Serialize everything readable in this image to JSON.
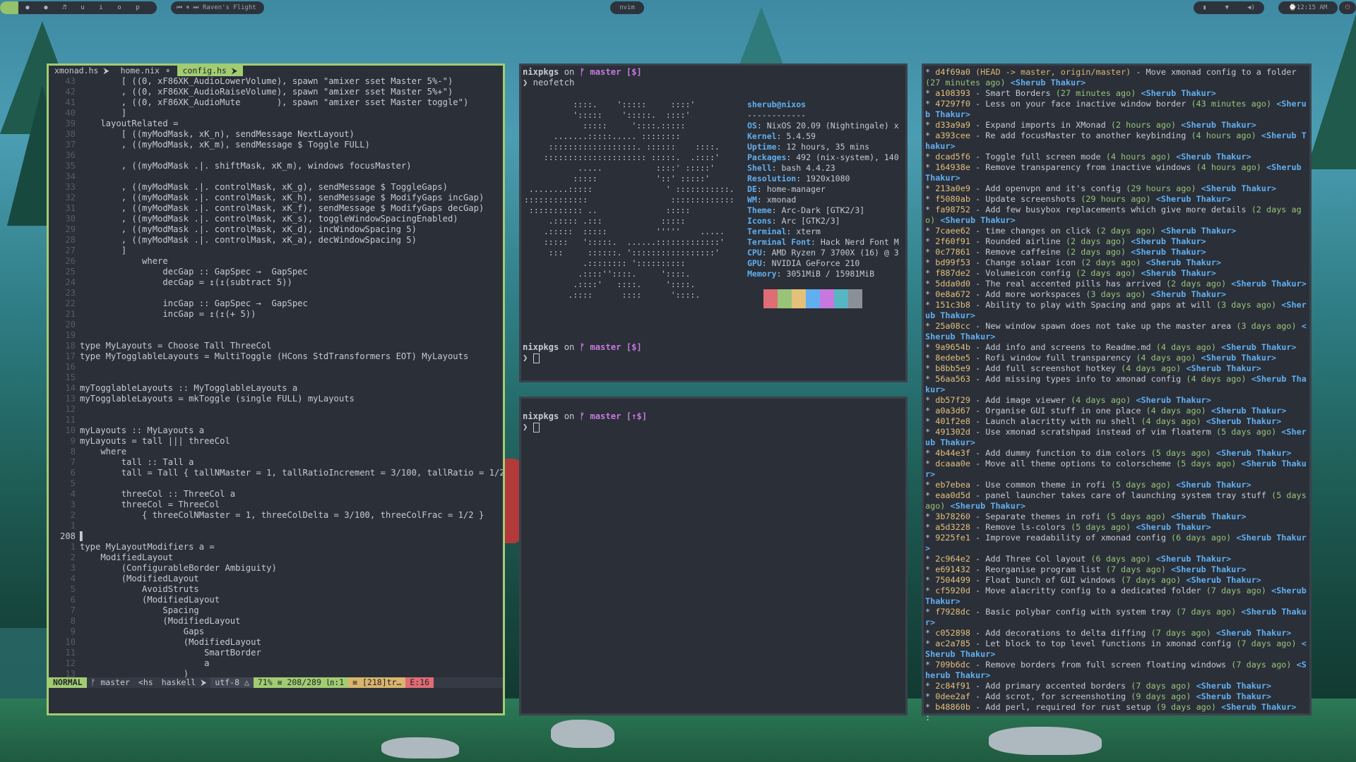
{
  "topbar": {
    "workspaces": [
      "",
      "●",
      "●",
      "♬",
      "u",
      "i",
      "o",
      "p"
    ],
    "music": "⏮ ⏸ ⏭ Raven's Flight",
    "center_title": "nvim",
    "clock": "⌚12:15 AM"
  },
  "nvim": {
    "tabs": [
      "xmonad.hs ⮞",
      "home.nix ⚬",
      "config.hs ⮞"
    ],
    "lines": [
      {
        "n": "43",
        "t": "        [ ((0, xF86XK_AudioLowerVolume), spawn \"amixer sset Master 5%-\")"
      },
      {
        "n": "42",
        "t": "        , ((0, xF86XK_AudioRaiseVolume), spawn \"amixer sset Master 5%+\")"
      },
      {
        "n": "41",
        "t": "        , ((0, xF86XK_AudioMute       ), spawn \"amixer sset Master toggle\")"
      },
      {
        "n": "40",
        "t": "        ]"
      },
      {
        "n": "39",
        "t": "    layoutRelated ="
      },
      {
        "n": "38",
        "t": "        [ ((myModMask, xK_n), sendMessage NextLayout)"
      },
      {
        "n": "37",
        "t": "        , ((myModMask, xK_m), sendMessage $ Toggle FULL)"
      },
      {
        "n": "36",
        "t": ""
      },
      {
        "n": "35",
        "t": "        , ((myModMask .|. shiftMask, xK_m), windows focusMaster)"
      },
      {
        "n": "34",
        "t": ""
      },
      {
        "n": "33",
        "t": "        , ((myModMask .|. controlMask, xK_g), sendMessage $ ToggleGaps)"
      },
      {
        "n": "32",
        "t": "        , ((myModMask .|. controlMask, xK_h), sendMessage $ ModifyGaps incGap)"
      },
      {
        "n": "31",
        "t": "        , ((myModMask .|. controlMask, xK_f), sendMessage $ ModifyGaps decGap)"
      },
      {
        "n": "30",
        "t": "        , ((myModMask .|. controlMask, xK_s), toggleWindowSpacingEnabled)"
      },
      {
        "n": "29",
        "t": "        , ((myModMask .|. controlMask, xK_d), incWindowSpacing 5)"
      },
      {
        "n": "28",
        "t": "        , ((myModMask .|. controlMask, xK_a), decWindowSpacing 5)"
      },
      {
        "n": "27",
        "t": "        ]"
      },
      {
        "n": "26",
        "t": "            where"
      },
      {
        "n": "25",
        "t": "                decGap :: GapSpec →  GapSpec"
      },
      {
        "n": "24",
        "t": "                decGap = ↥(↥(subtract 5))"
      },
      {
        "n": "23",
        "t": ""
      },
      {
        "n": "22",
        "t": "                incGap :: GapSpec →  GapSpec"
      },
      {
        "n": "21",
        "t": "                incGap = ↥(↥(+ 5))"
      },
      {
        "n": "20",
        "t": ""
      },
      {
        "n": "19",
        "t": ""
      },
      {
        "n": "18",
        "t": "type MyLayouts = Choose Tall ThreeCol"
      },
      {
        "n": "17",
        "t": "type MyTogglableLayouts = MultiToggle (HCons StdTransformers EOT) MyLayouts"
      },
      {
        "n": "16",
        "t": ""
      },
      {
        "n": "15",
        "t": ""
      },
      {
        "n": "14",
        "t": "myTogglableLayouts :: MyTogglableLayouts a"
      },
      {
        "n": "13",
        "t": "myTogglableLayouts = mkToggle (single FULL) myLayouts"
      },
      {
        "n": "12",
        "t": ""
      },
      {
        "n": "11",
        "t": ""
      },
      {
        "n": "10",
        "t": "myLayouts :: MyLayouts a"
      },
      {
        "n": "9",
        "t": "myLayouts = tall ||| threeCol"
      },
      {
        "n": "8",
        "t": "    where"
      },
      {
        "n": "7",
        "t": "        tall :: Tall a"
      },
      {
        "n": "6",
        "t": "        tall = Tall { tallNMaster = 1, tallRatioIncrement = 3/100, tallRatio = 1/2 }"
      },
      {
        "n": "5",
        "t": ""
      },
      {
        "n": "4",
        "t": "        threeCol :: ThreeCol a"
      },
      {
        "n": "3",
        "t": "        threeCol = ThreeCol"
      },
      {
        "n": "2",
        "t": "            { threeColNMaster = 1, threeColDelta = 3/100, threeColFrac = 1/2 }"
      },
      {
        "n": "1",
        "t": ""
      },
      {
        "n": "208",
        "t": "▌",
        "cur": true
      },
      {
        "n": "1",
        "t": "type MyLayoutModifiers a ="
      },
      {
        "n": "2",
        "t": "    ModifiedLayout"
      },
      {
        "n": "3",
        "t": "        (ConfigurableBorder Ambiguity)"
      },
      {
        "n": "4",
        "t": "        (ModifiedLayout"
      },
      {
        "n": "5",
        "t": "            AvoidStruts"
      },
      {
        "n": "6",
        "t": "            (ModifiedLayout"
      },
      {
        "n": "7",
        "t": "                Spacing"
      },
      {
        "n": "8",
        "t": "                (ModifiedLayout"
      },
      {
        "n": "9",
        "t": "                    Gaps"
      },
      {
        "n": "10",
        "t": "                    (ModifiedLayout"
      },
      {
        "n": "11",
        "t": "                        SmartBorder"
      },
      {
        "n": "12",
        "t": "                        a"
      },
      {
        "n": "13",
        "t": "                    )"
      }
    ],
    "status": {
      "mode": "NORMAL",
      "branch": "ᚠ master",
      "ft_short": "<hs",
      "filetype": "haskell ⮞",
      "encoding": "utf-8 △",
      "position": "71% ≡ 208/289 ㏑:1",
      "trailing": "≡ [218]tr…",
      "errors": "E:16"
    }
  },
  "term1": {
    "prompt_user": "nixpkgs",
    "prompt_on": " on ",
    "prompt_branch": "ᚠ master [$]",
    "command": "❯ neofetch",
    "ascii": [
      "          ::::.    ':::::     ::::'",
      "          ':::::    ':::::.  ::::'",
      "            :::::     '::::.:::::",
      "      .......:::::..... ::::::::",
      "     ::::::::::::::::::. ::::::    ::::.",
      "    ::::::::::::::::::::: :::::.  .::::'",
      "           .....           ::::' :::::'",
      "          :::::            '::' :::::'",
      " ........:::::               ' :::::::::::.",
      ":::::::::::::                 :::::::::::::",
      " ::::::::::: ..              :::::",
      "     .::::: .:::            :::::",
      "    .:::::  :::::          '''''    .....",
      "    :::::   ':::::.  ......:::::::::::::'",
      "     :::     ::::::. ':::::::::::::::::'",
      "            .:::::::: '::::::::::",
      "           .::::''::::.     '::::.",
      "          .::::'   ::::.     '::::.",
      "         .::::      ::::      '::::."
    ],
    "userhost": "sherub@nixos",
    "separator": "------------",
    "info": [
      {
        "k": "OS",
        "v": "NixOS 20.09 (Nightingale) x"
      },
      {
        "k": "Kernel",
        "v": "5.4.59"
      },
      {
        "k": "Uptime",
        "v": "12 hours, 35 mins"
      },
      {
        "k": "Packages",
        "v": "492 (nix-system), 140"
      },
      {
        "k": "Shell",
        "v": "bash 4.4.23"
      },
      {
        "k": "Resolution",
        "v": "1920x1080"
      },
      {
        "k": "DE",
        "v": "home-manager"
      },
      {
        "k": "WM",
        "v": "xmonad"
      },
      {
        "k": "Theme",
        "v": "Arc-Dark [GTK2/3]"
      },
      {
        "k": "Icons",
        "v": "Arc [GTK2/3]"
      },
      {
        "k": "Terminal",
        "v": "xterm"
      },
      {
        "k": "Terminal Font",
        "v": "Hack Nerd Font M"
      },
      {
        "k": "CPU",
        "v": "AMD Ryzen 7 3700X (16) @ 3"
      },
      {
        "k": "GPU",
        "v": "NVIDIA GeForce 210"
      },
      {
        "k": "Memory",
        "v": "3051MiB / 15981MiB"
      }
    ],
    "palette": [
      "#e06c75",
      "#98c379",
      "#e5c07b",
      "#61afef",
      "#c678dd",
      "#56b6c2",
      "#8a8f98"
    ],
    "prompt2_branch": "ᚠ master [$]",
    "cursor_prompt": "❯ "
  },
  "term2": {
    "prompt_user": "nixpkgs",
    "prompt_on": " on ",
    "prompt_branch": "ᚠ master [↑$]",
    "cursor_prompt": "❯ "
  },
  "git": {
    "entries": [
      {
        "h": "d4f69a0",
        "ref": "(HEAD -> master, origin/master)",
        "m": "Move xmonad config to a folder",
        "t": "(27 minutes ago)",
        "a": "<Sherub Thakur>"
      },
      {
        "h": "a108393",
        "m": "Smart Borders",
        "t": "(27 minutes ago)",
        "a": "<Sherub Thakur>"
      },
      {
        "h": "47297f0",
        "m": "Less on your face inactive window border",
        "t": "(43 minutes ago)",
        "a": "<Sherub Thakur>"
      },
      {
        "h": "d33a9a9",
        "m": "Expand imports in XMonad",
        "t": "(2 hours ago)",
        "a": "<Sherub Thakur>"
      },
      {
        "h": "a393cee",
        "m": "Re add focusMaster to another keybinding",
        "t": "(4 hours ago)",
        "a": "<Sherub Thakur>"
      },
      {
        "h": "dcad5f6",
        "m": "Toggle full screen mode",
        "t": "(4 hours ago)",
        "a": "<Sherub Thakur>"
      },
      {
        "h": "164938e",
        "m": "Remove transparency from inactive windows",
        "t": "(4 hours ago)",
        "a": "<Sherub Thakur>"
      },
      {
        "h": "213a0e9",
        "m": "Add openvpn and it's config",
        "t": "(29 hours ago)",
        "a": "<Sherub Thakur>"
      },
      {
        "h": "f5080ab",
        "m": "Update screenshots",
        "t": "(29 hours ago)",
        "a": "<Sherub Thakur>"
      },
      {
        "h": "fa98752",
        "m": "Add few busybox replacements which give more details",
        "t": "(2 days ago)",
        "a": "<Sherub Thakur>"
      },
      {
        "h": "7caee62",
        "m": "time changes on click",
        "t": "(2 days ago)",
        "a": "<Sherub Thakur>"
      },
      {
        "h": "2f60f91",
        "m": "Rounded airline",
        "t": "(2 days ago)",
        "a": "<Sherub Thakur>"
      },
      {
        "h": "0c77861",
        "m": "Remove caffeine",
        "t": "(2 days ago)",
        "a": "<Sherub Thakur>"
      },
      {
        "h": "bd99f53",
        "m": "Change solaar icon",
        "t": "(2 days ago)",
        "a": "<Sherub Thakur>"
      },
      {
        "h": "f887de2",
        "m": "Volumeicon config",
        "t": "(2 days ago)",
        "a": "<Sherub Thakur>"
      },
      {
        "h": "5dda0d0",
        "m": "The real accented pills has arrived",
        "t": "(2 days ago)",
        "a": "<Sherub Thakur>"
      },
      {
        "h": "0e8a672",
        "m": "Add more workspaces",
        "t": "(3 days ago)",
        "a": "<Sherub Thakur>"
      },
      {
        "h": "151c3b8",
        "m": "Ability to play with Spacing and gaps at will",
        "t": "(3 days ago)",
        "a": "<Sherub Thakur>"
      },
      {
        "h": "25a08cc",
        "m": "New window spawn does not take up the master area",
        "t": "(3 days ago)",
        "a": "<Sherub Thakur>"
      },
      {
        "h": "9a9654b",
        "m": "Add info and screens to Readme.md",
        "t": "(4 days ago)",
        "a": "<Sherub Thakur>"
      },
      {
        "h": "8edebe5",
        "m": "Rofi window full transparency",
        "t": "(4 days ago)",
        "a": "<Sherub Thakur>"
      },
      {
        "h": "b8bb5e9",
        "m": "Add full screenshot hotkey",
        "t": "(4 days ago)",
        "a": "<Sherub Thakur>"
      },
      {
        "h": "56aa563",
        "m": "Add missing types info to xmonad config",
        "t": "(4 days ago)",
        "a": "<Sherub Thakur>"
      },
      {
        "h": "db57f29",
        "m": "Add image viewer",
        "t": "(4 days ago)",
        "a": "<Sherub Thakur>"
      },
      {
        "h": "a0a3d67",
        "m": "Organise GUI stuff in one place",
        "t": "(4 days ago)",
        "a": "<Sherub Thakur>"
      },
      {
        "h": "401f2e8",
        "m": "Launch alacritty with nu shell",
        "t": "(4 days ago)",
        "a": "<Sherub Thakur>"
      },
      {
        "h": "491302d",
        "m": "Use xmonad scratshpad instead of vim floaterm",
        "t": "(5 days ago)",
        "a": "<Sherub Thakur>"
      },
      {
        "h": "4b44e3f",
        "m": "Add dummy function to dim colors",
        "t": "(5 days ago)",
        "a": "<Sherub Thakur>"
      },
      {
        "h": "dcaaa0e",
        "m": "Move all theme options to colorscheme",
        "t": "(5 days ago)",
        "a": "<Sherub Thakur>"
      },
      {
        "h": "eb7ebea",
        "m": "Use common theme in rofi",
        "t": "(5 days ago)",
        "a": "<Sherub Thakur>"
      },
      {
        "h": "eaa0d5d",
        "m": "panel launcher takes care of launching system tray stuff",
        "t": "(5 days ago)",
        "a": "<Sherub Thakur>"
      },
      {
        "h": "3b78260",
        "m": "Separate themes in rofi",
        "t": "(5 days ago)",
        "a": "<Sherub Thakur>"
      },
      {
        "h": "a5d3228",
        "m": "Remove ls-colors",
        "t": "(5 days ago)",
        "a": "<Sherub Thakur>"
      },
      {
        "h": "9225fe1",
        "m": "Improve readability of xmonad config",
        "t": "(6 days ago)",
        "a": "<Sherub Thakur>"
      },
      {
        "h": "2c964e2",
        "m": "Add Three Col layout",
        "t": "(6 days ago)",
        "a": "<Sherub Thakur>"
      },
      {
        "h": "e691432",
        "m": "Reorganise program list",
        "t": "(7 days ago)",
        "a": "<Sherub Thakur>"
      },
      {
        "h": "7504499",
        "m": "Float bunch of GUI windows",
        "t": "(7 days ago)",
        "a": "<Sherub Thakur>"
      },
      {
        "h": "cf5920d",
        "m": "Move alacritty config to a dedicated folder",
        "t": "(7 days ago)",
        "a": "<Sherub Thakur>"
      },
      {
        "h": "f7928dc",
        "m": "Basic polybar config with system tray",
        "t": "(7 days ago)",
        "a": "<Sherub Thakur>"
      },
      {
        "h": "c052898",
        "m": "Add decorations to delta diffing",
        "t": "(7 days ago)",
        "a": "<Sherub Thakur>"
      },
      {
        "h": "ac2a785",
        "m": "Let block to top level functions in xmonad config",
        "t": "(7 days ago)",
        "a": "<Sherub Thakur>"
      },
      {
        "h": "709b6dc",
        "m": "Remove borders from full screen floating windows",
        "t": "(7 days ago)",
        "a": "<Sherub Thakur>"
      },
      {
        "h": "2c84f91",
        "m": "Add primary accented borders",
        "t": "(7 days ago)",
        "a": "<Sherub Thakur>"
      },
      {
        "h": "0dee2af",
        "m": "Add scrot, for screenshoting",
        "t": "(9 days ago)",
        "a": "<Sherub Thakur>"
      },
      {
        "h": "b48860b",
        "m": "Add perl, required for rust setup",
        "t": "(9 days ago)",
        "a": "<Sherub Thakur>"
      }
    ],
    "pager": ":"
  }
}
